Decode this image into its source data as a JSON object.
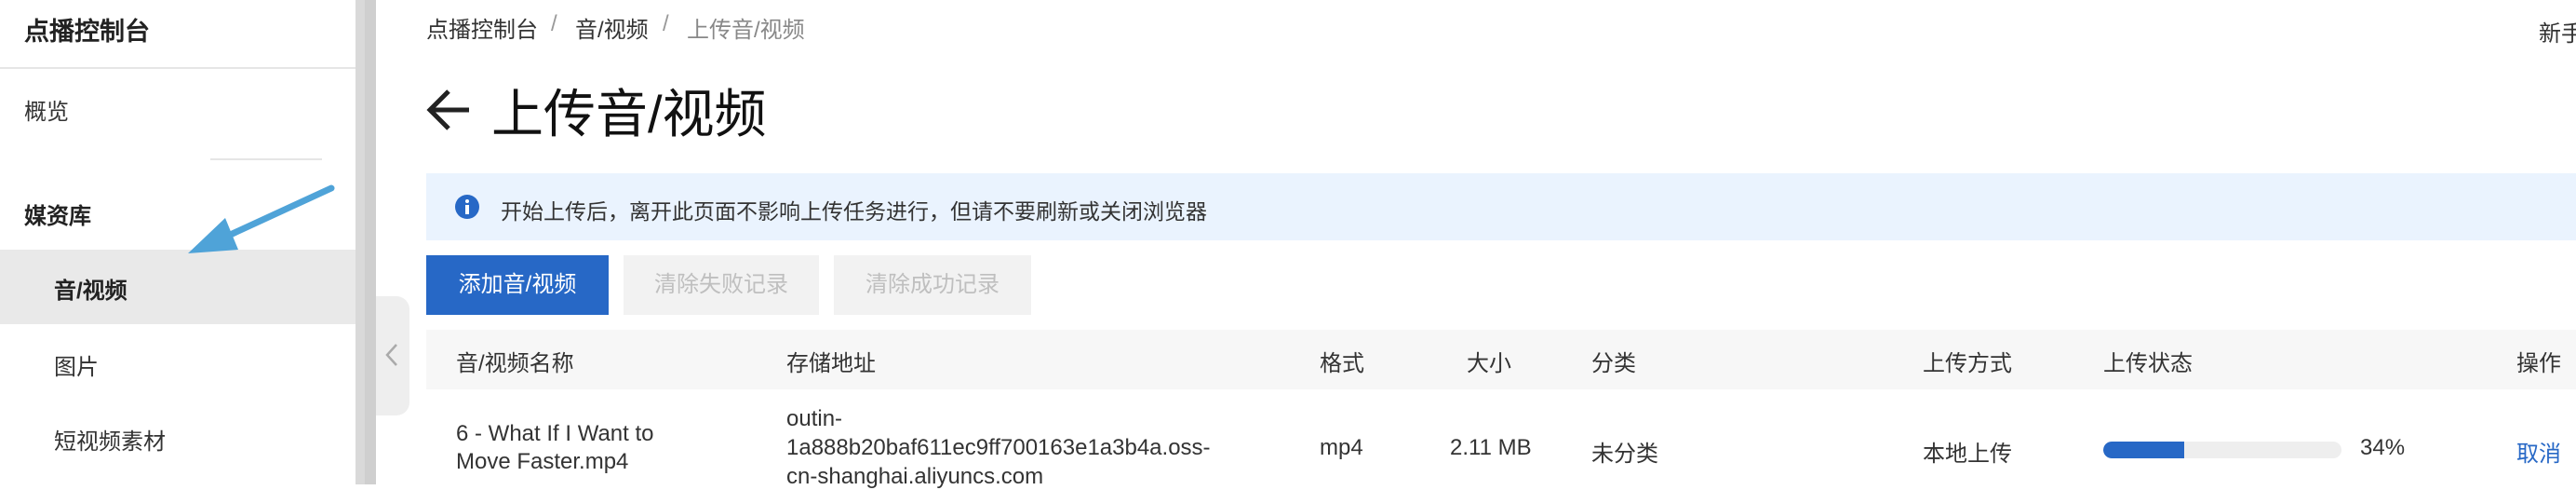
{
  "sidebar": {
    "title": "点播控制台",
    "overview": "概览",
    "group_label": "媒资库",
    "items": [
      {
        "label": "音/视频",
        "active": true
      },
      {
        "label": "图片",
        "active": false
      },
      {
        "label": "短视频素材",
        "active": false
      }
    ]
  },
  "header": {
    "breadcrumb": [
      "点播控制台",
      "音/视频",
      "上传音/视频"
    ],
    "newbie_text": "新手"
  },
  "page": {
    "title": "上传音/视频"
  },
  "alert": {
    "text": "开始上传后，离开此页面不影响上传任务进行，但请不要刷新或关闭浏览器"
  },
  "toolbar": {
    "add_label": "添加音/视频",
    "clear_failed_label": "清除失败记录",
    "clear_success_label": "清除成功记录"
  },
  "table": {
    "columns": [
      "音/视频名称",
      "存储地址",
      "格式",
      "大小",
      "分类",
      "上传方式",
      "上传状态",
      "操作"
    ],
    "rows": [
      {
        "name_line1": "6 - What If I Want to",
        "name_line2": "Move Faster.mp4",
        "address_line1": "outin-",
        "address_line2": "1a888b20baf611ec9ff700163e1a3b4a.oss-",
        "address_line3": "cn-shanghai.aliyuncs.com",
        "format": "mp4",
        "size": "2.11 MB",
        "category": "未分类",
        "upload_method": "本地上传",
        "progress": 0.34,
        "progress_label": "34%",
        "action": "取消"
      }
    ]
  },
  "colors": {
    "accent": "#2768c6",
    "annotation_arrow": "#4fa3d8",
    "alert_bg": "#eaf3fe"
  }
}
